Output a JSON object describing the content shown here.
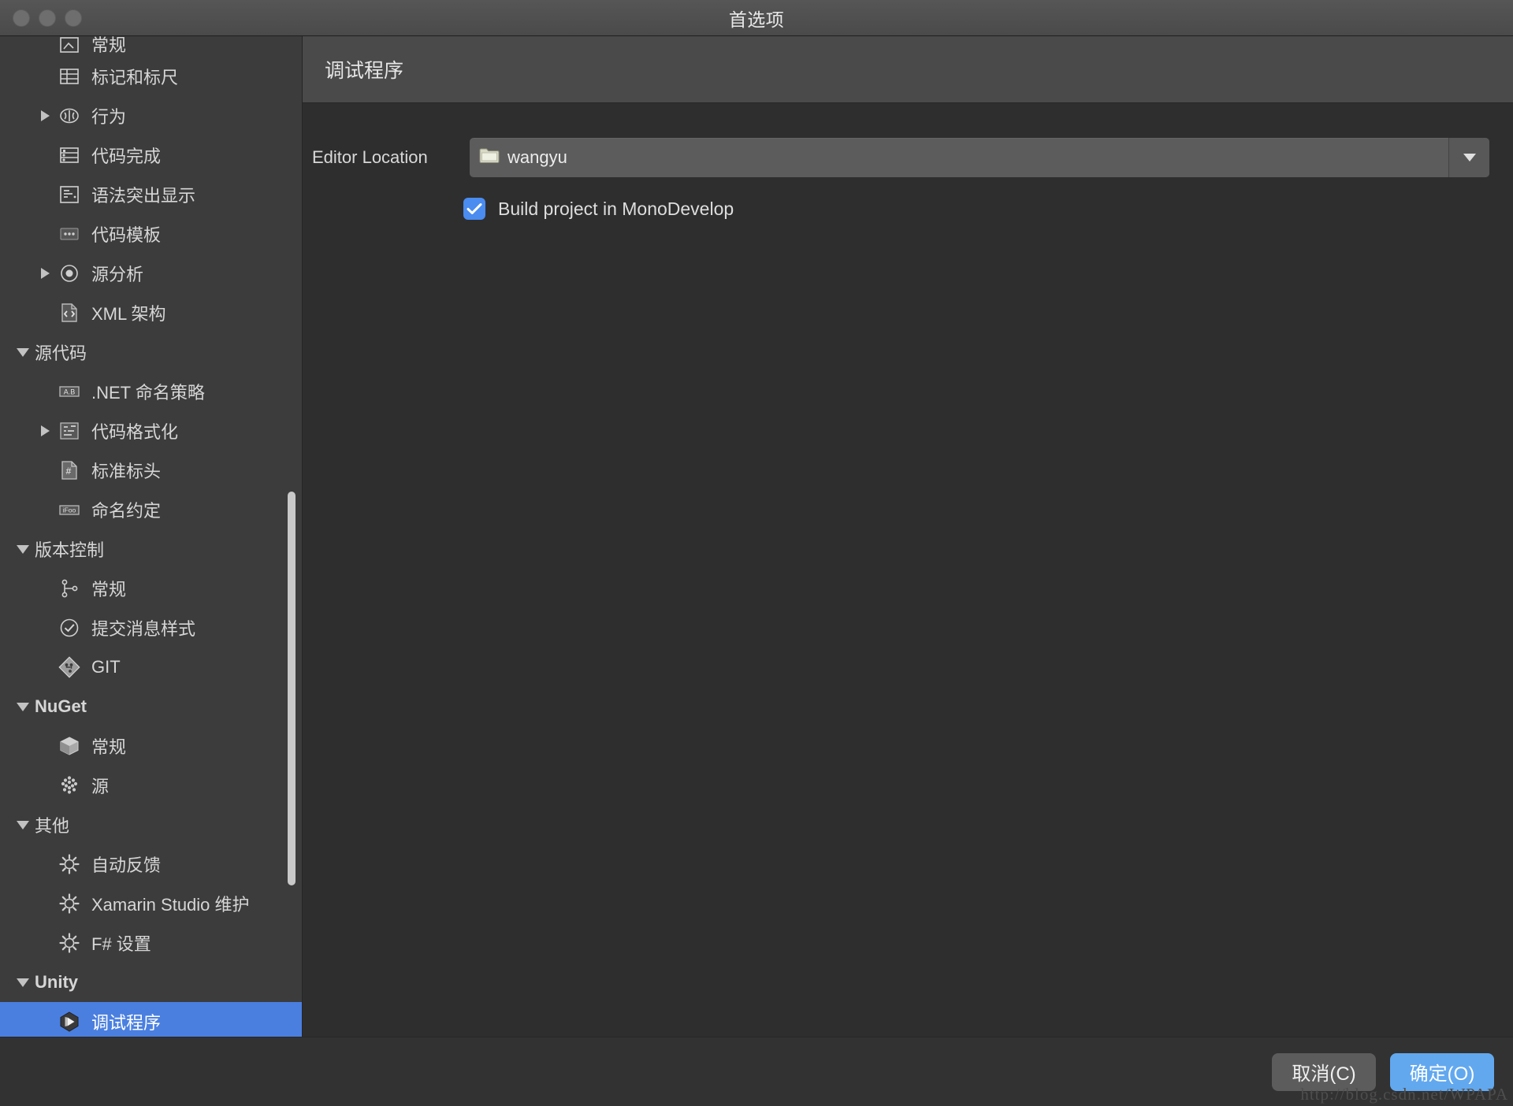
{
  "window": {
    "title": "首选项",
    "traffic_lights": [
      "close",
      "minimize",
      "zoom"
    ]
  },
  "sidebar": {
    "items": [
      {
        "label": "常规",
        "icon": "general-icon",
        "level": 1,
        "twisty": "none",
        "partial": true,
        "type": "item"
      },
      {
        "label": "标记和标尺",
        "icon": "markers-rulers-icon",
        "level": 1,
        "twisty": "none",
        "type": "item"
      },
      {
        "label": "行为",
        "icon": "behavior-brain-icon",
        "level": 1,
        "twisty": "right",
        "type": "item"
      },
      {
        "label": "代码完成",
        "icon": "code-completion-icon",
        "level": 1,
        "twisty": "none",
        "type": "item"
      },
      {
        "label": "语法突出显示",
        "icon": "syntax-highlight-icon",
        "level": 1,
        "twisty": "none",
        "type": "item"
      },
      {
        "label": "代码模板",
        "icon": "code-template-icon",
        "level": 1,
        "twisty": "none",
        "type": "item"
      },
      {
        "label": "源分析",
        "icon": "source-analysis-icon",
        "level": 1,
        "twisty": "right",
        "type": "item"
      },
      {
        "label": "XML 架构",
        "icon": "xml-schema-icon",
        "level": 1,
        "twisty": "none",
        "type": "item"
      },
      {
        "label": "源代码",
        "icon": "none",
        "level": 0,
        "twisty": "down",
        "type": "group"
      },
      {
        "label": ".NET 命名策略",
        "icon": "net-naming-icon",
        "level": 1,
        "twisty": "none",
        "type": "item"
      },
      {
        "label": "代码格式化",
        "icon": "code-format-icon",
        "level": 1,
        "twisty": "right",
        "type": "item"
      },
      {
        "label": "标准标头",
        "icon": "standard-header-icon",
        "level": 1,
        "twisty": "none",
        "type": "item"
      },
      {
        "label": "命名约定",
        "icon": "naming-convention-icon",
        "level": 1,
        "twisty": "none",
        "type": "item"
      },
      {
        "label": "版本控制",
        "icon": "none",
        "level": 0,
        "twisty": "down",
        "type": "group"
      },
      {
        "label": "常规",
        "icon": "vcs-general-icon",
        "level": 1,
        "twisty": "none",
        "type": "item"
      },
      {
        "label": "提交消息样式",
        "icon": "commit-message-icon",
        "level": 1,
        "twisty": "none",
        "type": "item"
      },
      {
        "label": "GIT",
        "icon": "git-icon",
        "level": 1,
        "twisty": "none",
        "type": "item"
      },
      {
        "label": "NuGet",
        "icon": "none",
        "level": 0,
        "twisty": "down",
        "type": "group",
        "bold": true
      },
      {
        "label": "常规",
        "icon": "nuget-package-icon",
        "level": 1,
        "twisty": "none",
        "type": "item"
      },
      {
        "label": "源",
        "icon": "nuget-sources-icon",
        "level": 1,
        "twisty": "none",
        "type": "item"
      },
      {
        "label": "其他",
        "icon": "none",
        "level": 0,
        "twisty": "down",
        "type": "group"
      },
      {
        "label": "自动反馈",
        "icon": "gear-icon",
        "level": 1,
        "twisty": "none",
        "type": "item"
      },
      {
        "label": "Xamarin Studio 维护",
        "icon": "gear-icon",
        "level": 1,
        "twisty": "none",
        "type": "item"
      },
      {
        "label": "F# 设置",
        "icon": "gear-icon",
        "level": 1,
        "twisty": "none",
        "type": "item"
      },
      {
        "label": "Unity",
        "icon": "none",
        "level": 0,
        "twisty": "down",
        "type": "group",
        "bold": true
      },
      {
        "label": "调试程序",
        "icon": "unity-icon",
        "level": 1,
        "twisty": "none",
        "type": "item",
        "selected": true
      }
    ]
  },
  "content": {
    "header_title": "调试程序",
    "editor_location": {
      "label": "Editor Location",
      "value": "wangyu",
      "icon": "folder-icon"
    },
    "build_checkbox": {
      "label": "Build project in MonoDevelop",
      "checked": true
    }
  },
  "footer": {
    "cancel_label": "取消(C)",
    "ok_label": "确定(O)"
  },
  "watermark": "http://blog.csdn.net/WPAPA",
  "colors": {
    "window_bg": "#2e2e2e",
    "sidebar_bg": "#3c3c3c",
    "titlebar_bg": "#4f4f4f",
    "selection_blue": "#4a7fe0",
    "accent_blue": "#62a8ef",
    "checkbox_blue": "#4a8cf0",
    "text": "#d6d6d6"
  }
}
